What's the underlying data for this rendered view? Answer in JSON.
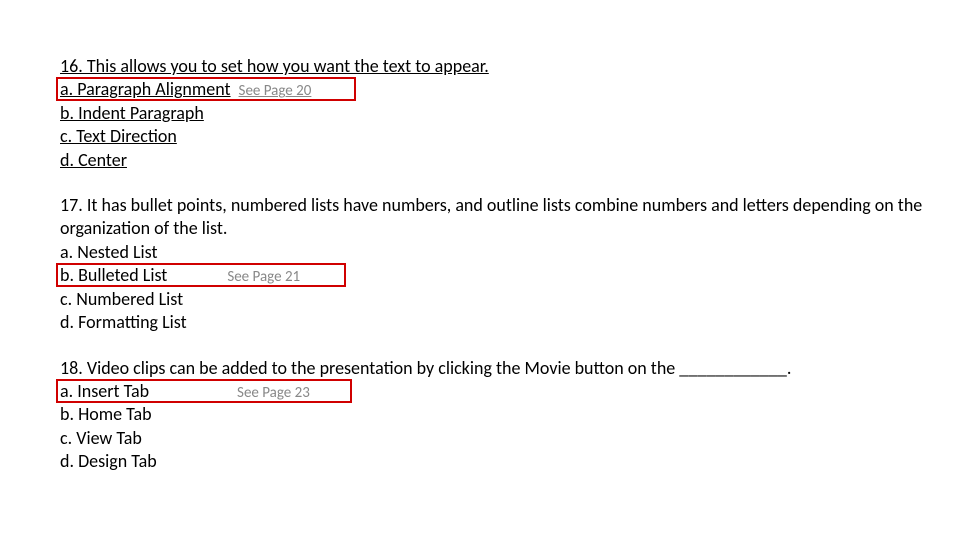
{
  "q16": {
    "prompt": "16. This allows you to set how you want the text to appear.",
    "a": "a. Paragraph Alignment",
    "a_ref": "See Page 20",
    "b": "b. Indent Paragraph",
    "c": "c. Text Direction",
    "d": "d. Center"
  },
  "q17": {
    "prompt": "17. It has bullet points, numbered lists have numbers, and outline lists combine numbers and letters depending on the organization of the list.",
    "a": "a. Nested List",
    "b": "b. Bulleted List",
    "b_ref": "See Page 21",
    "c": "c. Numbered List",
    "d": "d. Formatting List"
  },
  "q18": {
    "prompt": "18. Video clips can be added to the presentation by clicking the Movie button on the ____________.",
    "a": "a. Insert Tab",
    "a_ref": "See Page 23",
    "b": "b. Home Tab",
    "c": "c. View Tab",
    "d": "d. Design Tab"
  }
}
